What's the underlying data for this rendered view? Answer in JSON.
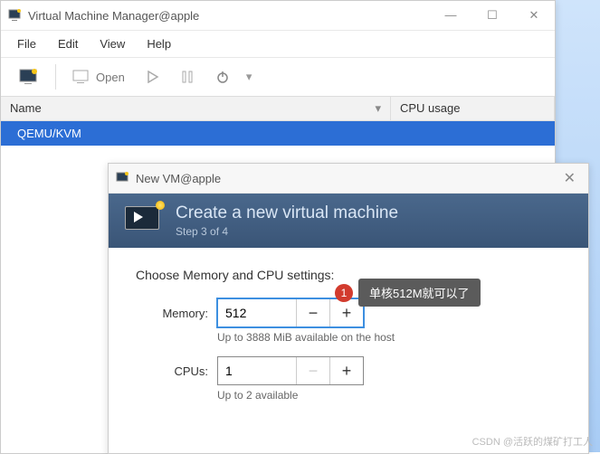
{
  "main": {
    "title": "Virtual Machine Manager@apple",
    "menu": {
      "file": "File",
      "edit": "Edit",
      "view": "View",
      "help": "Help"
    },
    "toolbar": {
      "open": "Open"
    },
    "columns": {
      "name": "Name",
      "cpu": "CPU usage"
    },
    "rows": [
      {
        "name": "QEMU/KVM"
      }
    ]
  },
  "dialog": {
    "title": "New VM@apple",
    "heading": "Create a new virtual machine",
    "step": "Step 3 of 4",
    "section": "Choose Memory and CPU settings:",
    "memory": {
      "label": "Memory:",
      "value": "512",
      "hint": "Up to 3888 MiB available on the host"
    },
    "cpus": {
      "label": "CPUs:",
      "value": "1",
      "hint": "Up to 2 available"
    }
  },
  "annotation": {
    "num": "1",
    "text": "单核512M就可以了"
  },
  "watermark": "CSDN @活跃的煤矿打工人"
}
